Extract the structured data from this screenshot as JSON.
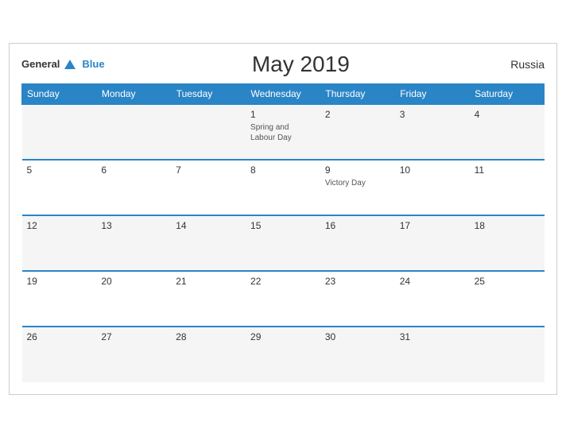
{
  "header": {
    "logo_general": "General",
    "logo_blue": "Blue",
    "title": "May 2019",
    "country": "Russia"
  },
  "weekdays": [
    "Sunday",
    "Monday",
    "Tuesday",
    "Wednesday",
    "Thursday",
    "Friday",
    "Saturday"
  ],
  "weeks": [
    [
      {
        "day": "",
        "holiday": ""
      },
      {
        "day": "",
        "holiday": ""
      },
      {
        "day": "",
        "holiday": ""
      },
      {
        "day": "1",
        "holiday": "Spring and Labour Day"
      },
      {
        "day": "2",
        "holiday": ""
      },
      {
        "day": "3",
        "holiday": ""
      },
      {
        "day": "4",
        "holiday": ""
      }
    ],
    [
      {
        "day": "5",
        "holiday": ""
      },
      {
        "day": "6",
        "holiday": ""
      },
      {
        "day": "7",
        "holiday": ""
      },
      {
        "day": "8",
        "holiday": ""
      },
      {
        "day": "9",
        "holiday": "Victory Day"
      },
      {
        "day": "10",
        "holiday": ""
      },
      {
        "day": "11",
        "holiday": ""
      }
    ],
    [
      {
        "day": "12",
        "holiday": ""
      },
      {
        "day": "13",
        "holiday": ""
      },
      {
        "day": "14",
        "holiday": ""
      },
      {
        "day": "15",
        "holiday": ""
      },
      {
        "day": "16",
        "holiday": ""
      },
      {
        "day": "17",
        "holiday": ""
      },
      {
        "day": "18",
        "holiday": ""
      }
    ],
    [
      {
        "day": "19",
        "holiday": ""
      },
      {
        "day": "20",
        "holiday": ""
      },
      {
        "day": "21",
        "holiday": ""
      },
      {
        "day": "22",
        "holiday": ""
      },
      {
        "day": "23",
        "holiday": ""
      },
      {
        "day": "24",
        "holiday": ""
      },
      {
        "day": "25",
        "holiday": ""
      }
    ],
    [
      {
        "day": "26",
        "holiday": ""
      },
      {
        "day": "27",
        "holiday": ""
      },
      {
        "day": "28",
        "holiday": ""
      },
      {
        "day": "29",
        "holiday": ""
      },
      {
        "day": "30",
        "holiday": ""
      },
      {
        "day": "31",
        "holiday": ""
      },
      {
        "day": "",
        "holiday": ""
      }
    ]
  ],
  "colors": {
    "header_bg": "#2a85c7",
    "border": "#2a85c7",
    "even_row": "#ffffff",
    "odd_row": "#f5f5f5"
  }
}
